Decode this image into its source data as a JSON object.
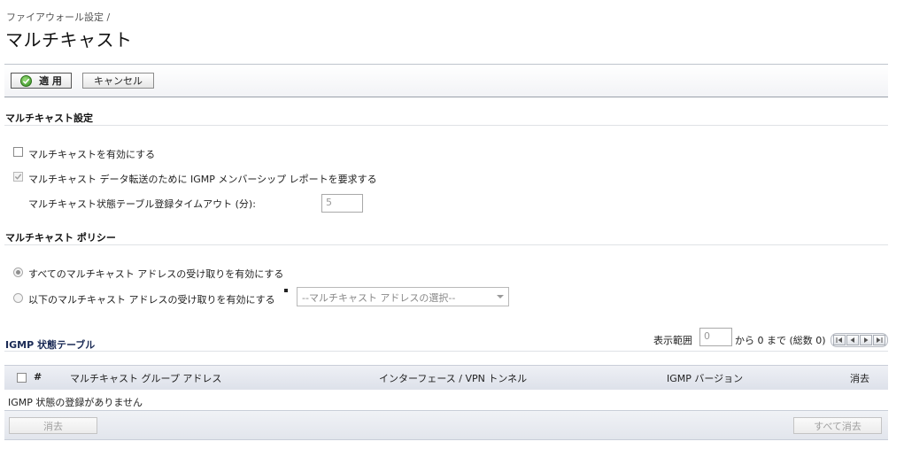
{
  "header": {
    "breadcrumb": "ファイアウォール設定 /",
    "title": "マルチキャスト"
  },
  "toolbar": {
    "apply_label": "適 用",
    "cancel_label": "キャンセル"
  },
  "multicast_settings": {
    "title": "マルチキャスト設定",
    "enable_label": "マルチキャストを有効にする",
    "igmp_require_label": "マルチキャスト データ転送のために IGMP メンバーシップ レポートを要求する",
    "timeout_label": "マルチキャスト状態テーブル登録タイムアウト (分):",
    "timeout_value": "5"
  },
  "multicast_policy": {
    "title": "マルチキャスト ポリシー",
    "all_label": "すべてのマルチキャスト アドレスの受け取りを有効にする",
    "below_label": "以下のマルチキャスト アドレスの受け取りを有効にする",
    "select_value": "--マルチキャスト アドレスの選択--"
  },
  "igmp_table": {
    "title": "IGMP 状態テーブル",
    "range_label": "表示範囲",
    "range_value": "0",
    "range_suffix": "から 0 まで (総数 0)",
    "columns": {
      "num": "#",
      "group_address": "マルチキャスト グループ アドレス",
      "interface": "インターフェース / VPN トンネル",
      "igmp_version": "IGMP バージョン",
      "delete": "消去"
    },
    "empty_message": "IGMP 状態の登録がありません",
    "delete_button": "消去",
    "delete_all_button": "すべて消去"
  },
  "colors": {
    "accent": "#2f8a1e",
    "table_header": "#dde1ea"
  }
}
